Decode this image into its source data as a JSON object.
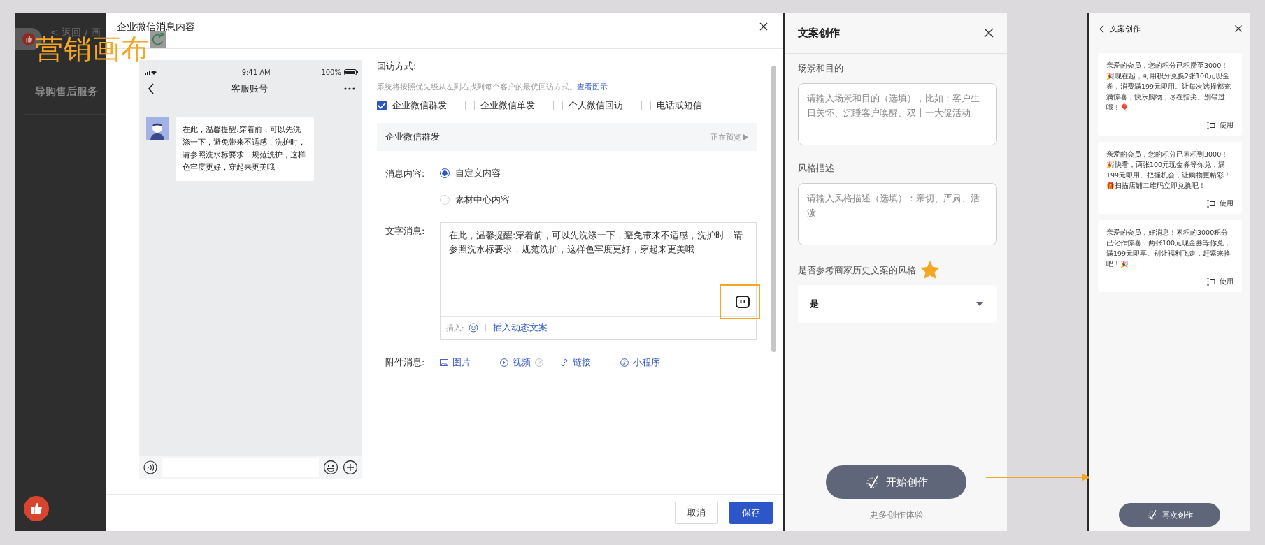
{
  "background_page": {
    "breadcrumb": "< 返回 / 画",
    "title": "导购售后服务"
  },
  "overlay_title": "营销画布",
  "modal": {
    "title": "企业微信消息内容",
    "phone": {
      "time": "9:41 AM",
      "battery": "100%",
      "title": "客服账号",
      "message": "在此，温馨提醒:穿着前，可以先洗涤一下，避免带来不适感，洗护时，请参照洗水标要求，规范洗护，这样色牢度更好，穿起来更美哦"
    },
    "form": {
      "visit_label": "回访方式:",
      "hint": "系统将按照优先级从左到右找到每个客户的最优回访方式。",
      "hint_link": "查看图示",
      "methods": [
        {
          "label": "企业微信群发",
          "checked": true
        },
        {
          "label": "企业微信单发",
          "checked": false
        },
        {
          "label": "个人微信回访",
          "checked": false
        },
        {
          "label": "电话或短信",
          "checked": false
        }
      ],
      "section": {
        "title": "企业微信群发",
        "status": "正在预览"
      },
      "content_label": "消息内容:",
      "content_options": [
        {
          "label": "自定义内容",
          "selected": true
        },
        {
          "label": "素材中心内容",
          "selected": false
        }
      ],
      "text_label": "文字消息:",
      "text_value": "在此，温馨提醒:穿着前，可以先洗涤一下，避免带来不适感，洗护时，请参照洗水标要求，规范洗护，这样色牢度更好，穿起来更美哦",
      "insert_label": "插入:",
      "insert_link": "插入动态文案",
      "attach_label": "附件消息:",
      "attachments": [
        {
          "kind": "image",
          "label": "图片",
          "help": false
        },
        {
          "kind": "video",
          "label": "视频",
          "help": true
        },
        {
          "kind": "link",
          "label": "链接",
          "help": false
        },
        {
          "kind": "miniapp",
          "label": "小程序",
          "help": false
        }
      ]
    },
    "buttons": [
      {
        "kind": "secondary",
        "label": "取消"
      },
      {
        "kind": "primary",
        "label": "保存"
      }
    ]
  },
  "create_panel": {
    "title": "文案创作",
    "scene_label": "场景和目的",
    "scene_placeholder": "请输入场景和目的（选填），比如：客户生日关怀、沉睡客户唤醒、双十一大促活动",
    "style_label": "风格描述",
    "style_placeholder": "请输入风格描述（选填）：亲切、严肃、活泼",
    "reference_label": "是否参考商家历史文案的风格",
    "reference_value": "是",
    "button": "开始创作",
    "more": "更多创作体验"
  },
  "result_panel": {
    "title": "文案创作",
    "results": [
      {
        "text": "亲爱的会员，您的积分已积攒至3000！🎉现在起，可用积分兑换2张100元现金券，消费满199元即用。让每次选择都充满惊喜，快乐购物，尽在指尖。别错过哦！🎈",
        "action": "使用"
      },
      {
        "text": "亲爱的会员，您的积分已累积到3000！🎉快看，两张100元现金券等你兑，满199元即用。把握机会，让购物更精彩！🎁扫描店铺二维码立即兑换吧！",
        "action": "使用"
      },
      {
        "text": "亲爱的会员，好消息！累积的3000积分已化作惊喜：两张100元现金券等你兑，满199元即享。别让福利飞走，赶紧来换吧！🎉",
        "action": "使用"
      }
    ],
    "button": "再次创作"
  }
}
